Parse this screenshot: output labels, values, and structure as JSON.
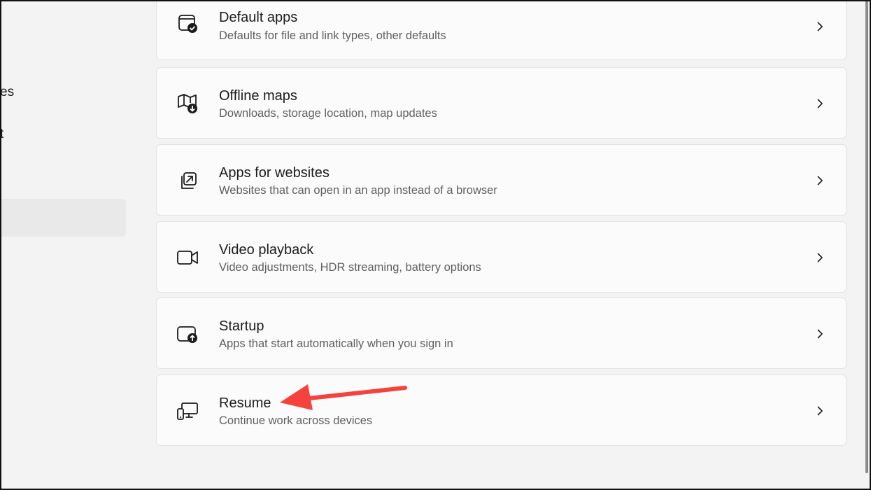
{
  "nav": {
    "fragment_1": "es",
    "fragment_2": "t"
  },
  "cards": [
    {
      "title": "Default apps",
      "desc": "Defaults for file and link types, other defaults",
      "icon": "default-apps-icon"
    },
    {
      "title": "Offline maps",
      "desc": "Downloads, storage location, map updates",
      "icon": "offline-maps-icon"
    },
    {
      "title": "Apps for websites",
      "desc": "Websites that can open in an app instead of a browser",
      "icon": "apps-for-websites-icon"
    },
    {
      "title": "Video playback",
      "desc": "Video adjustments, HDR streaming, battery options",
      "icon": "video-camera-icon"
    },
    {
      "title": "Startup",
      "desc": "Apps that start automatically when you sign in",
      "icon": "startup-icon"
    },
    {
      "title": "Resume",
      "desc": "Continue work across devices",
      "icon": "resume-devices-icon"
    }
  ],
  "annotation": {
    "arrow_color": "#f5423d"
  }
}
